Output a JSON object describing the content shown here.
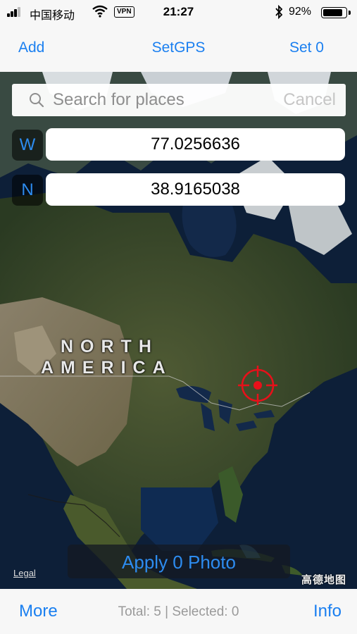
{
  "status_bar": {
    "carrier": "中国移动",
    "vpn": "VPN",
    "time": "21:27",
    "battery_percent": "92%",
    "battery_level": 0.92,
    "icons": [
      "signal-icon",
      "wifi-icon",
      "bluetooth-icon",
      "battery-icon"
    ]
  },
  "nav": {
    "add_label": "Add",
    "title": "SetGPS",
    "set_label": "Set 0"
  },
  "search": {
    "placeholder": "Search for places",
    "cancel_label": "Cancel"
  },
  "coordinates": {
    "longitude_label": "W",
    "longitude_value": "77.0256636",
    "latitude_label": "N",
    "latitude_value": "38.9165038"
  },
  "map": {
    "label_line1": "NORTH",
    "label_line2": "AMERICA",
    "legal_label": "Legal",
    "provider_logo": "高德地图",
    "marker_color": "#e8101a"
  },
  "apply_button_label": "Apply 0 Photo",
  "toolbar": {
    "more_label": "More",
    "status_text": "Total: 5 | Selected: 0",
    "info_label": "Info"
  },
  "colors": {
    "accent": "#1a7ff0",
    "map_ocean": "#0d1f38"
  }
}
